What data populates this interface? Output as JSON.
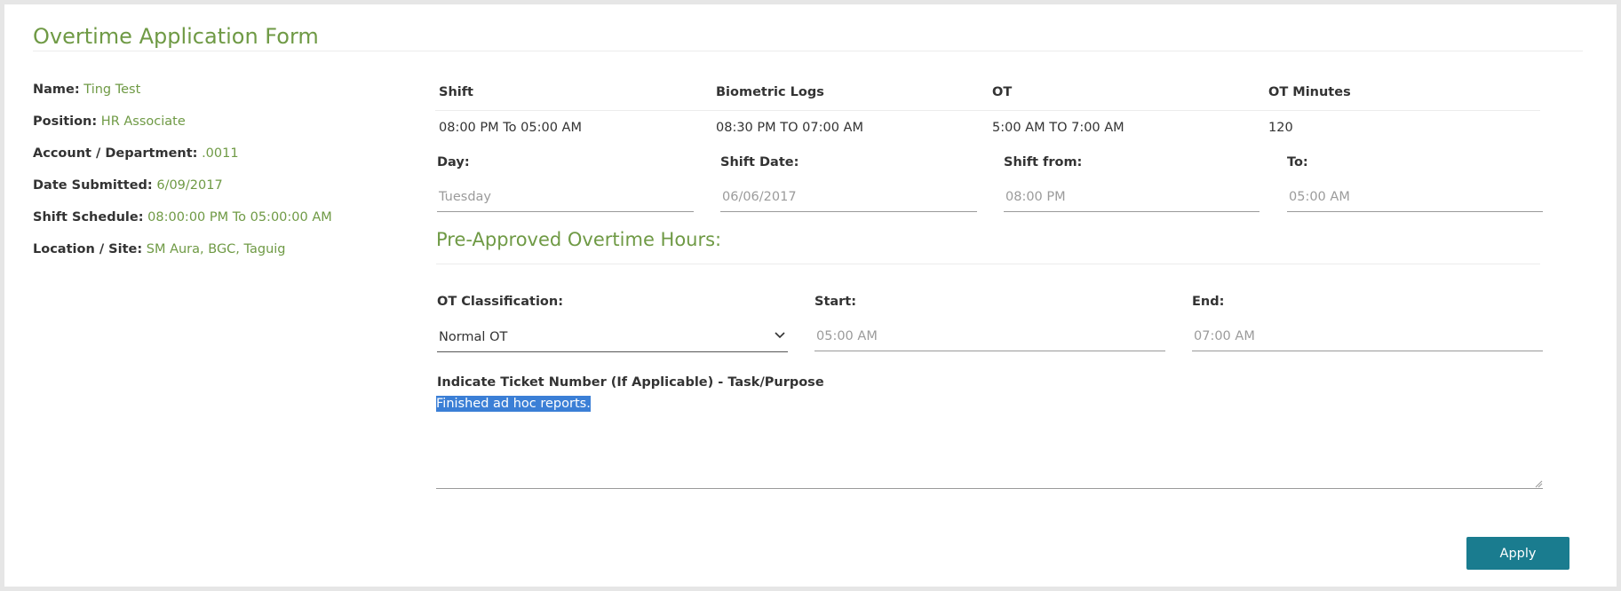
{
  "form": {
    "title": "Overtime Application Form",
    "apply_label": "Apply"
  },
  "employee": [
    {
      "label": "Name:",
      "value": "Ting Test"
    },
    {
      "label": "Position:",
      "value": "HR Associate"
    },
    {
      "label": "Account / Department:",
      "value": ".0011"
    },
    {
      "label": "Date Submitted:",
      "value": "6/09/2017"
    },
    {
      "label": "Shift Schedule:",
      "value": "08:00:00 PM To 05:00:00 AM"
    },
    {
      "label": "Location / Site:",
      "value": "SM Aura, BGC, Taguig"
    }
  ],
  "summary": {
    "headers": [
      "Shift",
      "Biometric Logs",
      "OT",
      "OT Minutes"
    ],
    "values": [
      "08:00 PM To 05:00 AM",
      "08:30 PM TO 07:00 AM",
      "5:00 AM TO 7:00 AM",
      "120"
    ]
  },
  "shift_fields": [
    {
      "label": "Day:",
      "value": "Tuesday"
    },
    {
      "label": "Shift Date:",
      "value": "06/06/2017"
    },
    {
      "label": "Shift from:",
      "value": "08:00 PM"
    },
    {
      "label": "To:",
      "value": "05:00 AM"
    }
  ],
  "preapproved": {
    "title": "Pre-Approved Overtime Hours:",
    "classification_label": "OT Classification:",
    "classification_value": "Normal OT",
    "start_label": "Start:",
    "start_value": "05:00 AM",
    "end_label": "End:",
    "end_value": "07:00 AM",
    "ticket_label": "Indicate Ticket Number (If Applicable) - Task/Purpose",
    "ticket_value": "Finished ad hoc reports."
  },
  "colors": {
    "accent_green": "#6f9a45",
    "button_teal": "#1a7c8f",
    "selection_blue": "#3b7fd6"
  },
  "icons": {
    "dropdown": "chevron-down-icon",
    "resize": "resize-grip-icon"
  }
}
